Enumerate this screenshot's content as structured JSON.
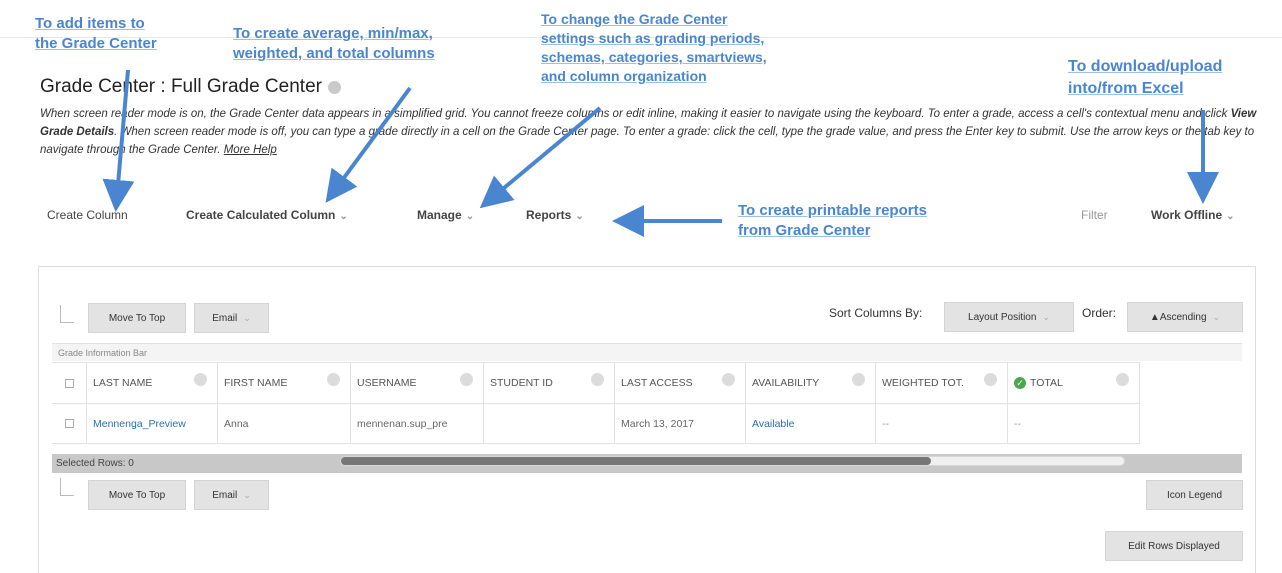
{
  "page": {
    "title": "Grade Center : Full Grade Center",
    "instructions": {
      "part1": "When screen reader mode is on, the Grade Center data appears in a simplified grid. You cannot freeze columns or edit inline, making it easier to navigate using the keyboard. To enter a grade, access a cell's contextual menu and click ",
      "bold": "View Grade Details",
      "part2": ". When screen reader mode is off, you can type a grade directly in a cell on the Grade Center page. To enter a grade: click the cell, type the grade value, and press the Enter key to submit. Use the arrow keys or the tab key to navigate through the Grade Center. ",
      "more_help": "More Help"
    }
  },
  "action_bar": {
    "create_column": "Create Column",
    "create_calculated_column": "Create Calculated Column",
    "manage": "Manage",
    "reports": "Reports",
    "filter": "Filter",
    "work_offline": "Work Offline"
  },
  "toolbar": {
    "move_to_top": "Move To Top",
    "email": "Email",
    "sort_columns_by_label": "Sort Columns By:",
    "sort_value": "Layout Position",
    "order_label": "Order:",
    "order_value": "▲Ascending",
    "grade_information_bar": "Grade Information Bar",
    "icon_legend": "Icon Legend",
    "edit_rows_displayed": "Edit Rows Displayed",
    "selected_rows": "Selected Rows: 0"
  },
  "table": {
    "headers": [
      "LAST NAME",
      "FIRST NAME",
      "USERNAME",
      "STUDENT ID",
      "LAST ACCESS",
      "AVAILABILITY",
      "WEIGHTED TOT.",
      "TOTAL"
    ],
    "row": [
      "Mennenga_Preview",
      "Anna",
      "mennenan.sup_pre",
      "",
      "March 13, 2017",
      "Available",
      "--",
      "--"
    ]
  },
  "annotations": {
    "add_items": [
      "To add items to",
      "the Grade Center"
    ],
    "calculated": [
      "To create average, min/max,",
      "weighted, and total columns"
    ],
    "settings": [
      "To change the Grade Center",
      "settings such as grading periods,",
      "schemas, categories, smartviews,",
      "and column organization"
    ],
    "excel": [
      "To download/upload",
      "into/from Excel"
    ],
    "reports": [
      "To create printable reports",
      "from Grade Center"
    ]
  },
  "colors": {
    "annotation_blue": "#4a86d0",
    "link_blue": "#2a6fb5",
    "button_gray": "#e3e3e3"
  }
}
